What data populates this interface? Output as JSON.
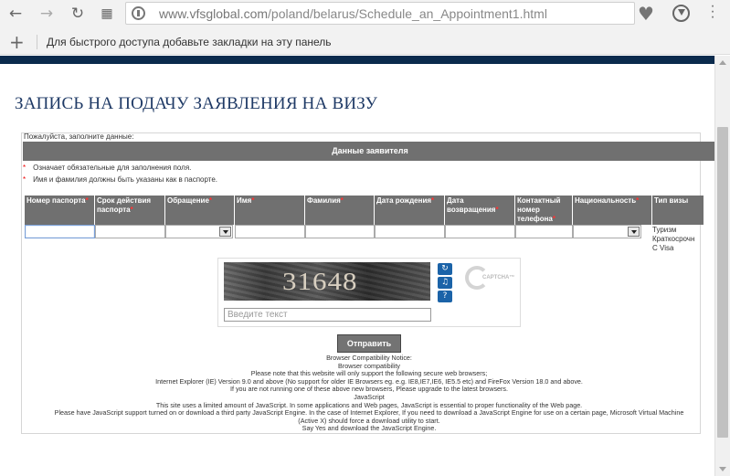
{
  "browser": {
    "url_host": "www.vfsglobal.com",
    "url_path": "/poland/belarus/Schedule_an_Appointment1.html",
    "bookmarks_hint": "Для быстрого доступа добавьте закладки на эту панель"
  },
  "page": {
    "title": "ЗАПИСЬ НА ПОДАЧУ ЗАЯВЛЕНИЯ НА ВИЗУ",
    "fill_note": "Пожалуйста, заполните данные:",
    "section_header": "Данные заявителя",
    "required_note": "Означает обязательные для заполнения поля.",
    "passport_note": "Имя и фамилия должны быть указаны как в паспорте.",
    "required_star": "*",
    "columns": [
      {
        "label": "Номер паспорта",
        "required": "*"
      },
      {
        "label": "Срок действия паспорта",
        "required": "*"
      },
      {
        "label": "Обращение",
        "required": "*"
      },
      {
        "label": "Имя",
        "required": "*"
      },
      {
        "label": "Фамилия",
        "required": "*"
      },
      {
        "label": "Дата рождения",
        "required": "*"
      },
      {
        "label": "Дата возвращения",
        "required": "*"
      },
      {
        "label": "Контактный номер телефона",
        "required": "*"
      },
      {
        "label": "Национальность",
        "required": "*"
      },
      {
        "label": "Тип визы",
        "required": ""
      }
    ],
    "visa_type_options": [
      "Туризм",
      "Краткосрочн",
      "С Visa"
    ],
    "captcha": {
      "code": "31648",
      "placeholder": "Введите текст",
      "logo_text": "CAPTCHA™"
    },
    "submit_label": "Отправить",
    "compat_lines": [
      "Browser Compatibility Notice:",
      "Browser compatibility",
      "Please note that this website will only support the following secure web browsers;",
      "Internet Explorer (IE) Version 9.0 and above (No support for older IE Browsers eg. e.g. IE8,IE7,IE6, IE5.5 etc) and FireFox Version 18.0 and above.",
      "If you are not running one of these above new browsers, Please upgrade to the latest browsers.",
      "JavaScript",
      "This site uses a limited amount of JavaScript. In some applications and Web pages, JavaScript is essential to proper functionality of the Web page.",
      "Please have JavaScript support turned on or download a third party JavaScript Engine. In the case of Internet Explorer, If you need to download a JavaScript Engine for use on a certain page, Microsoft Virtual Machine",
      "(Active X) should force a download utility to start.",
      "Say Yes and download the JavaScript Engine."
    ]
  }
}
